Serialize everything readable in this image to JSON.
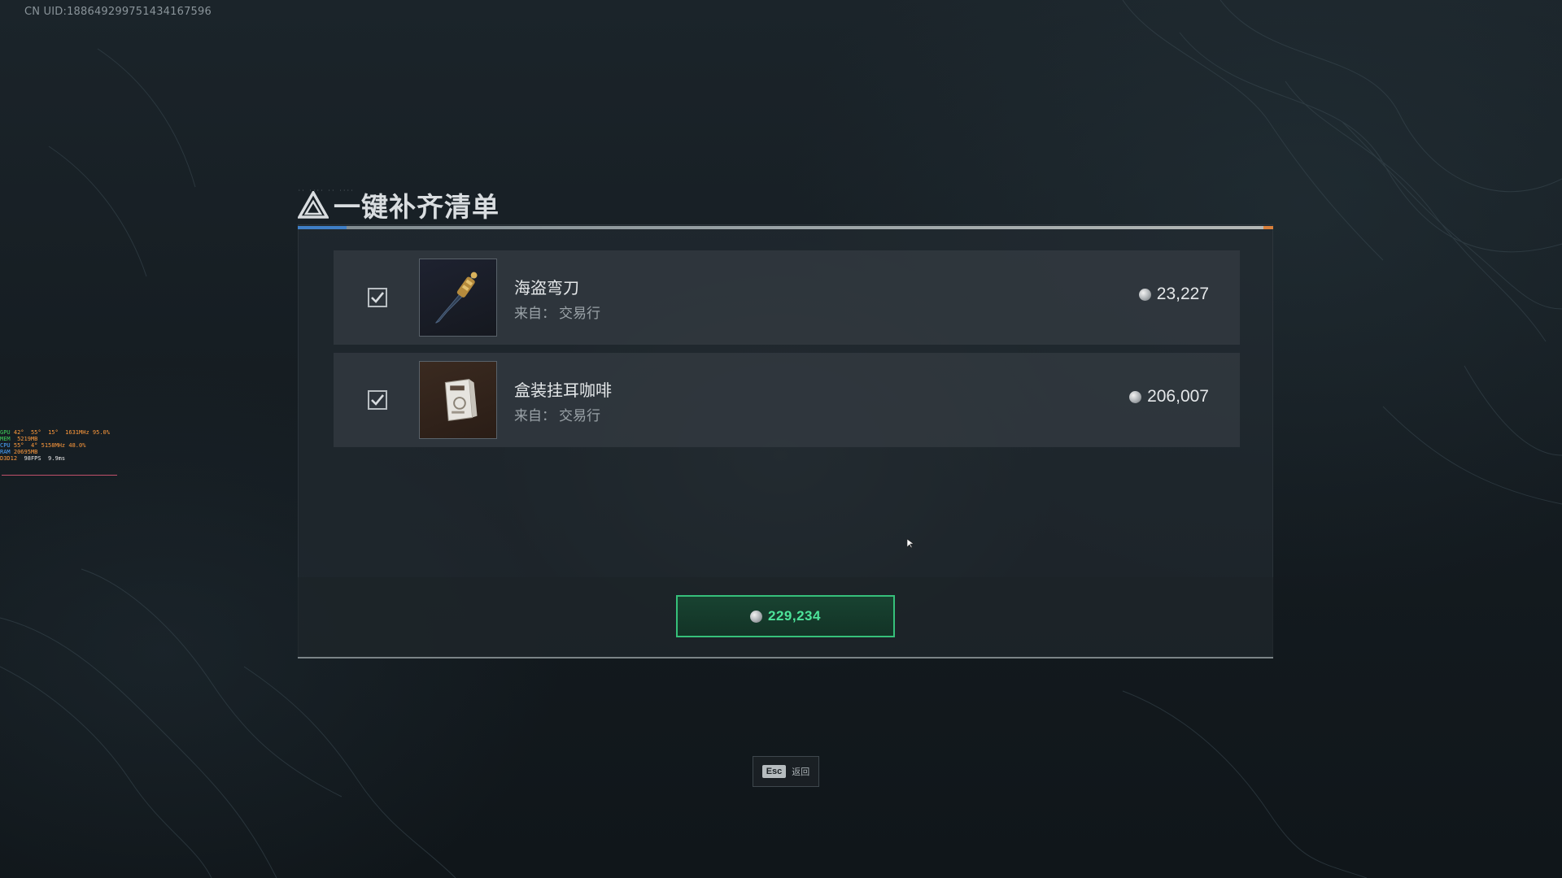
{
  "uid_text": "CN UID:18864929975143416759​6",
  "perf_overlay": {
    "rows": [
      {
        "key": "GPU",
        "vals": [
          "42°",
          "55°",
          "15°",
          "1631MHz",
          "95.0%"
        ]
      },
      {
        "key": "MEM",
        "vals": [
          "5219MB"
        ]
      },
      {
        "key": "CPU",
        "vals": [
          "55°",
          "4°",
          "5158MHz",
          "48.0%"
        ]
      },
      {
        "key": "RAM",
        "vals": [
          "20695MB"
        ]
      },
      {
        "key": "D3D12",
        "vals": [
          "98FPS",
          "9.9ms"
        ]
      }
    ]
  },
  "dialog": {
    "title": "一键补齐清单",
    "icon": "triangle-alert-icon"
  },
  "items": [
    {
      "name": "海盗弯刀",
      "source_label": "来自：",
      "source": "交易行",
      "price": "23,227",
      "checked": true,
      "icon": "pirate-cutlass-icon"
    },
    {
      "name": "盒装挂耳咖啡",
      "source_label": "来自：",
      "source": "交易行",
      "price": "206,007",
      "checked": true,
      "icon": "boxed-drip-coffee-icon"
    }
  ],
  "total": {
    "value": "229,234",
    "icon": "coin-icon"
  },
  "footer": {
    "key": "Esc",
    "label": "返回"
  },
  "colors": {
    "accent_green": "#36c07a",
    "total_text": "#4de39a",
    "panel_bg": "#242c32"
  }
}
